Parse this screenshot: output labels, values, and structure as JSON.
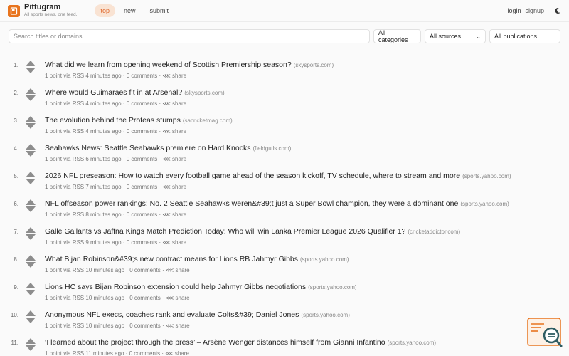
{
  "header": {
    "brand_name": "Pittugram",
    "tagline": "All sports news, one feed.",
    "nav": [
      {
        "label": "top"
      },
      {
        "label": "new"
      },
      {
        "label": "submit"
      }
    ],
    "login_label": "login",
    "signup_label": "signup",
    "theme_icon": "moon-icon"
  },
  "filters": {
    "search_placeholder": "Search titles or domains...",
    "categories_label": "All categories",
    "sources_label": "All sources",
    "publications_label": "All publications"
  },
  "colors": {
    "accent": "#e0692d",
    "active_tab_bg": "#f9e3d3"
  },
  "items": [
    {
      "rank": "1.",
      "title": "What did we learn from opening weekend of Scottish Premiership season?",
      "domain": "(skysports.com)",
      "meta": "1 point via RSS 4 minutes ago",
      "comments": "0 comments",
      "share": "share"
    },
    {
      "rank": "2.",
      "title": "Where would Guimaraes fit in at Arsenal?",
      "domain": "(skysports.com)",
      "meta": "1 point via RSS 4 minutes ago",
      "comments": "0 comments",
      "share": "share"
    },
    {
      "rank": "3.",
      "title": "The evolution behind the Proteas stumps",
      "domain": "(sacricketmag.com)",
      "meta": "1 point via RSS 4 minutes ago",
      "comments": "0 comments",
      "share": "share"
    },
    {
      "rank": "4.",
      "title": "Seahawks News: Seattle Seahawks premiere on Hard Knocks",
      "domain": "(fieldgulls.com)",
      "meta": "1 point via RSS 6 minutes ago",
      "comments": "0 comments",
      "share": "share"
    },
    {
      "rank": "5.",
      "title": "2026 NFL preseason: How to watch every football game ahead of the season kickoff, TV schedule, where to stream and more",
      "domain": "(sports.yahoo.com)",
      "meta": "1 point via RSS 7 minutes ago",
      "comments": "0 comments",
      "share": "share"
    },
    {
      "rank": "6.",
      "title": "NFL offseason power rankings: No. 2 Seattle Seahawks weren&#39;t just a Super Bowl champion, they were a dominant one",
      "domain": "(sports.yahoo.com)",
      "meta": "1 point via RSS 8 minutes ago",
      "comments": "0 comments",
      "share": "share"
    },
    {
      "rank": "7.",
      "title": "Galle Gallants vs Jaffna Kings Match Prediction Today: Who will win Lanka Premier League 2026 Qualifier 1?",
      "domain": "(cricketaddictor.com)",
      "meta": "1 point via RSS 9 minutes ago",
      "comments": "0 comments",
      "share": "share"
    },
    {
      "rank": "8.",
      "title": "What Bijan Robinson&#39;s new contract means for Lions RB Jahmyr Gibbs",
      "domain": "(sports.yahoo.com)",
      "meta": "1 point via RSS 10 minutes ago",
      "comments": "0 comments",
      "share": "share"
    },
    {
      "rank": "9.",
      "title": "Lions HC says Bijan Robinson extension could help Jahmyr Gibbs negotiations",
      "domain": "(sports.yahoo.com)",
      "meta": "1 point via RSS 10 minutes ago",
      "comments": "0 comments",
      "share": "share"
    },
    {
      "rank": "10.",
      "title": "Anonymous NFL execs, coaches rank and evaluate Colts&#39; Daniel Jones",
      "domain": "(sports.yahoo.com)",
      "meta": "1 point via RSS 10 minutes ago",
      "comments": "0 comments",
      "share": "share"
    },
    {
      "rank": "11.",
      "title": "‘I learned about the project through the press’ – Arsène Wenger distances himself from Gianni Infantino",
      "domain": "(sports.yahoo.com)",
      "meta": "1 point via RSS 11 minutes ago",
      "comments": "0 comments",
      "share": "share"
    }
  ]
}
